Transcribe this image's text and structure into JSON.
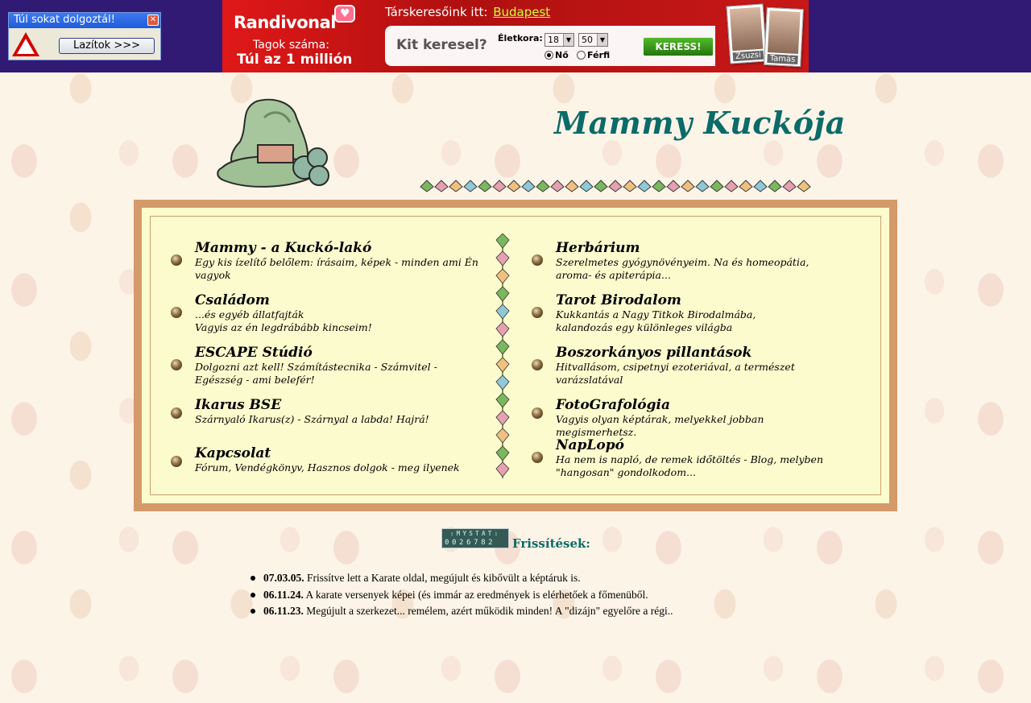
{
  "warn_ad": {
    "title": "Túl sokat dolgoztál!",
    "button_label": "Lazítok >>>"
  },
  "dating_ad": {
    "brand": "Randivonal",
    "members_label": "Tagok száma:",
    "members_value": "Túl az 1 millión",
    "search_prefix": "Társkeresőink itt:",
    "search_city": "Budapest",
    "kit_label": "Kit keresel?",
    "age_label": "Életkora:",
    "age_min": "18",
    "age_max": "50",
    "gender_female": "Nő",
    "gender_male": "Férfi",
    "gender_selected": "Nő",
    "search_button": "KERESS!",
    "profiles": [
      "Zsuzsi",
      "Tamás"
    ]
  },
  "header": {
    "site_title": "Mammy Kuckója"
  },
  "menu": {
    "left": [
      {
        "title": "Mammy - a Kuckó-lakó",
        "desc": [
          "Egy kis ízelítő belőlem: írásaim, képek - minden ami Én vagyok"
        ]
      },
      {
        "title": "Családom",
        "desc": [
          "...és egyéb állatfajták",
          "Vagyis az én legdrábább kincseim!"
        ]
      },
      {
        "title": "ESCAPE Stúdió",
        "desc": [
          "Dolgozni azt kell! Számítástecnika - Számvitel - Egészség - ami belefér!"
        ]
      },
      {
        "title": "Ikarus BSE",
        "desc": [
          "Szárnyaló Ikarus(z) - Szárnyal a labda! Hajrá!"
        ]
      },
      {
        "title": "Kapcsolat",
        "desc": [
          "Fórum, Vendégkönyv, Hasznos dolgok - meg ilyenek"
        ]
      }
    ],
    "right": [
      {
        "title": "Herbárium",
        "desc": [
          "Szerelmetes gyógynövényeim. Na és homeopátia, aroma- és apiterápia..."
        ]
      },
      {
        "title": "Tarot Birodalom",
        "desc": [
          "Kukkantás a Nagy Titkok Birodalmába,",
          "kalandozás egy különleges világba"
        ]
      },
      {
        "title": "Boszorkányos pillantások",
        "desc": [
          "Hitvallásom, csipetnyi ezoteriával, a természet varázslatával"
        ]
      },
      {
        "title": "FotoGrafológia",
        "desc": [
          "Vagyis olyan képtárak, melyekkel jobban megismerhetsz."
        ]
      },
      {
        "title": "NapLopó",
        "desc": [
          "Ha nem is napló, de remek időtöltés - Blog, melyben",
          "\"hangosan\" gondolkodom..."
        ]
      }
    ]
  },
  "counter": {
    "label": ":MYSTAT:",
    "digits": "0026782"
  },
  "updates": {
    "title": "Frissítések:",
    "items": [
      {
        "date": "07.03.05.",
        "text": "Frissítve lett a Karate oldal, megújult és kibővült a képtáruk is."
      },
      {
        "date": "06.11.24.",
        "text": "A karate versenyek képei (és immár az eredmények is elérhetőek a főmenüből."
      },
      {
        "date": "06.11.23.",
        "text": "Megújult a szerkezet... remélem, azért működik minden! A \"dizájn\" egyelőre a régi.."
      }
    ]
  },
  "colors": {
    "top_bar": "#311a74",
    "title_teal": "#0b6b68",
    "menu_frame": "#d49a6a",
    "menu_bg": "#fcfbcd",
    "page_bg": "#fdf4e8"
  }
}
